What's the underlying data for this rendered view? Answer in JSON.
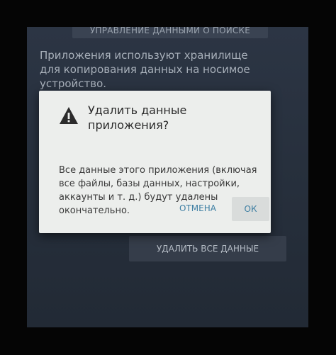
{
  "background": {
    "top_button_label": "Управление данными о поиске",
    "description": "Приложения используют хранилище для копирования данных на носимое устройство.",
    "bottom_button_label": "Удалить все данные"
  },
  "dialog": {
    "icon": "warning-triangle-icon",
    "title": "Удалить данные приложения?",
    "message": "Все данные этого приложения (включая все файлы, базы данных, настройки, аккаунты и т. д.) будут удалены окончательно.",
    "cancel_label": "Отмена",
    "ok_label": "ОК"
  },
  "colors": {
    "accent": "#3e7fa3",
    "dialog_bg": "#eceeec",
    "screen_bg": "#27303d"
  }
}
